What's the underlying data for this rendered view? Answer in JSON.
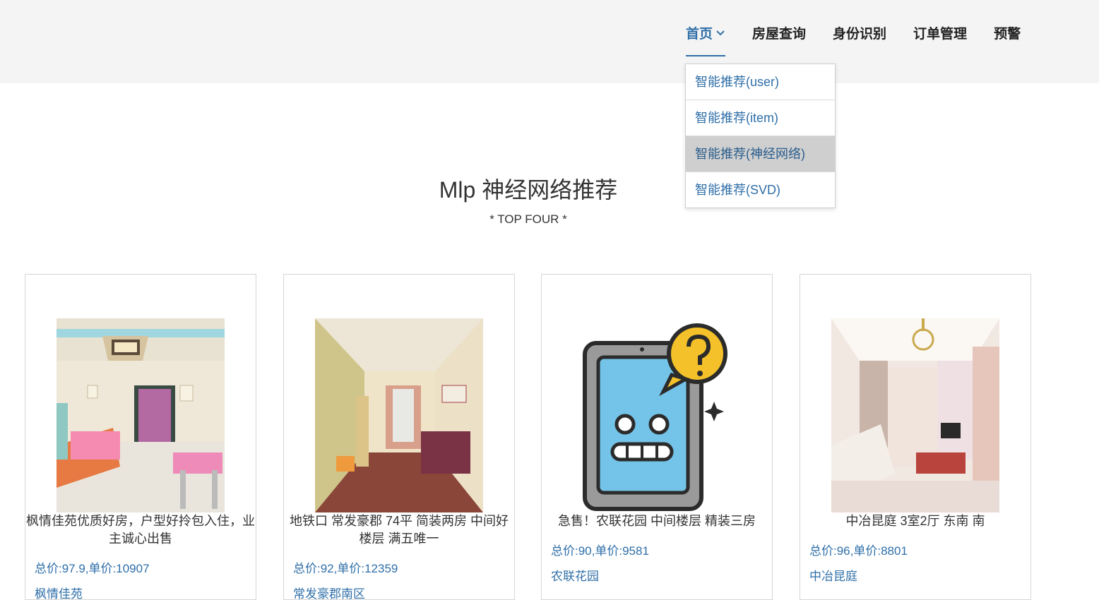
{
  "nav": {
    "items": [
      {
        "label": "首页",
        "active": true
      },
      {
        "label": "房屋查询"
      },
      {
        "label": "身份识别"
      },
      {
        "label": "订单管理"
      },
      {
        "label": "预警"
      }
    ]
  },
  "dropdown": {
    "items": [
      {
        "label": "智能推荐(user)"
      },
      {
        "label": "智能推荐(item)"
      },
      {
        "label": "智能推荐(神经网络)",
        "selected": true
      },
      {
        "label": "智能推荐(SVD)"
      }
    ]
  },
  "section": {
    "title": "Mlp 神经网络推荐",
    "subtitle": "* TOP FOUR *"
  },
  "cards": [
    {
      "name": "枫情佳苑优质好房，户型好拎包入住，业主诚心出售",
      "price": "总价:97.9,单价:10907",
      "community": "枫情佳苑",
      "image": "living-room-photo"
    },
    {
      "name": "地铁口 常发豪郡 74平 简装两房 中间好楼层 满五唯一",
      "price": "总价:92,单价:12359",
      "community": "常发豪郡南区",
      "image": "living-room-photo"
    },
    {
      "name": "急售！农联花园 中间楼层 精装三房",
      "price": "总价:90,单价:9581",
      "community": "农联花园",
      "image": "missing-image-robot-icon"
    },
    {
      "name": "中冶昆庭 3室2厅 东南 南",
      "price": "总价:96,单价:8801",
      "community": "中冶昆庭",
      "image": "living-room-photo"
    }
  ],
  "colors": {
    "accent": "#2f6fa8",
    "header_bg": "#f4f4f4",
    "selected_bg": "#cfcfcf"
  }
}
